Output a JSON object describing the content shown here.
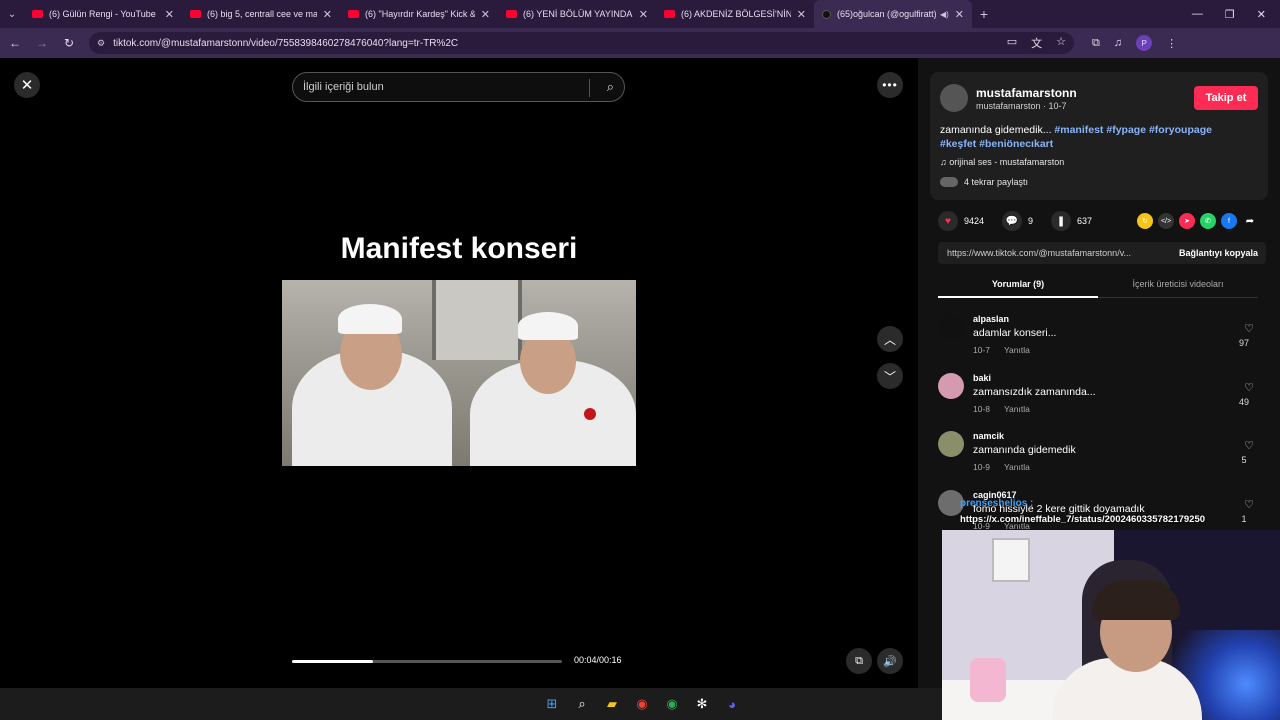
{
  "browser": {
    "tabs": [
      {
        "title": "(6) Gülün Rengi - YouTube",
        "favicon": "youtube-icon"
      },
      {
        "title": "(6) big 5, centrall cee ve mançu",
        "favicon": "youtube-icon"
      },
      {
        "title": "(6) \"Hayırdır Kardeş\" Kick & Tw",
        "favicon": "youtube-icon"
      },
      {
        "title": "(6) YENİ BÖLÜM YAYINDA",
        "favicon": "youtube-icon"
      },
      {
        "title": "(6) AKDENİZ BÖLGESİ'NİN EN D",
        "favicon": "youtube-icon"
      },
      {
        "title": "(65)oğulcan (@ogulfiratt) |",
        "favicon": "tiktok-icon",
        "active": true
      }
    ],
    "url": "tiktok.com/@mustafamarstonn/video/7558398460278476040?lang=tr-TR%2C"
  },
  "search": {
    "placeholder": "İlgili içeriği bulun"
  },
  "video": {
    "title": "Manifest konseri",
    "time": "00:04/00:16",
    "progress_fraction": 0.3
  },
  "creator": {
    "username": "mustafamarstonn",
    "subline": "mustafamarston · 10-7",
    "follow_label": "Takip et",
    "description_text": "zamanında gidemedik...",
    "hashtags_line1": [
      "#manifest",
      "#fypage",
      "#foryoupage"
    ],
    "hashtags_line2": [
      "#keşfet",
      "#beniönecıkart"
    ],
    "music": "orijinal ses - mustafamarston",
    "shared": "4 tekrar paylaştı"
  },
  "stats": {
    "likes": "9424",
    "comments": "9",
    "saves": "637"
  },
  "link": {
    "url": "https://www.tiktok.com/@mustafamarstonn/v...",
    "copy_label": "Bağlantıyı kopyala"
  },
  "panel_tabs": [
    "Yorumlar (9)",
    "İçerik üreticisi videoları"
  ],
  "comments": [
    {
      "name": "alpaslan",
      "text": "adamlar konseri...",
      "date": "10-7",
      "reply": "Yanıtla",
      "likes": "97"
    },
    {
      "name": "baki",
      "text": "zamansızdık zamanında...",
      "date": "10-8",
      "reply": "Yanıtla",
      "likes": "49"
    },
    {
      "name": "namcik",
      "text": "zamanında gidemedik",
      "date": "10-9",
      "reply": "Yanıtla",
      "likes": "5"
    },
    {
      "name": "cagin0617",
      "text": "fomo hissiyle 2 kere gittik doyamadık",
      "date": "10-9",
      "reply": "Yanıtla",
      "likes": "1"
    }
  ],
  "overlay": {
    "user": "prenseshelios :",
    "link": "https://x.com/ineffable_7/status/2002460335782179250"
  },
  "colors": {
    "accent": "#fe2c55",
    "hashtag": "#8ab4f8",
    "tab_bg": "#2a1b3d",
    "toolbar_bg": "#3b2b52"
  }
}
